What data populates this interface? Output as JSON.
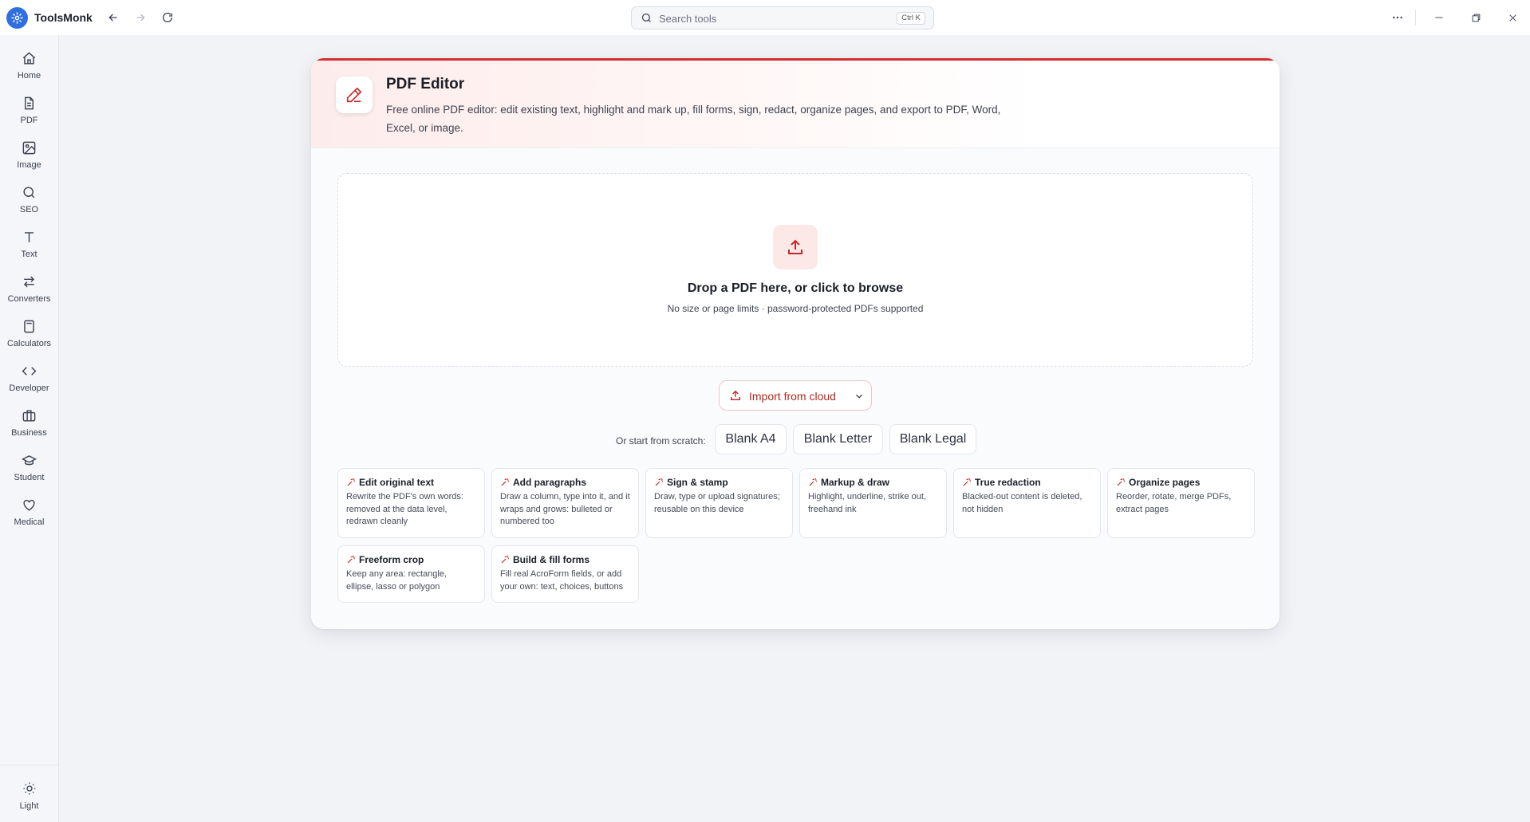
{
  "app": {
    "name": "ToolsMonk",
    "search_placeholder": "Search tools",
    "search_shortcut": "Ctrl K"
  },
  "sidebar": {
    "items": [
      {
        "label": "Home",
        "icon": "home-icon"
      },
      {
        "label": "PDF",
        "icon": "file-icon"
      },
      {
        "label": "Image",
        "icon": "image-icon"
      },
      {
        "label": "SEO",
        "icon": "search-icon"
      },
      {
        "label": "Text",
        "icon": "type-icon"
      },
      {
        "label": "Converters",
        "icon": "arrows-icon"
      },
      {
        "label": "Calculators",
        "icon": "calculator-icon"
      },
      {
        "label": "Developer",
        "icon": "code-icon"
      },
      {
        "label": "Business",
        "icon": "briefcase-icon"
      },
      {
        "label": "Student",
        "icon": "graduation-cap-icon"
      },
      {
        "label": "Medical",
        "icon": "heart-icon"
      }
    ],
    "theme_label": "Light"
  },
  "tool": {
    "title": "PDF Editor",
    "description": "Free online PDF editor: edit existing text, highlight and mark up, fill forms, sign, redact, organize pages, and export to PDF, Word, Excel, or image.",
    "accent_color": "#d32f2f"
  },
  "dropzone": {
    "title": "Drop a PDF here, or click to browse",
    "subtitle": "No size or page limits · password-protected PDFs supported"
  },
  "cloud": {
    "label": "Import from cloud"
  },
  "scratch": {
    "label": "Or start from scratch:",
    "options": [
      "Blank A4",
      "Blank Letter",
      "Blank Legal"
    ]
  },
  "features": [
    {
      "title": "Edit original text",
      "desc": "Rewrite the PDF's own words: removed at the data level, redrawn cleanly"
    },
    {
      "title": "Add paragraphs",
      "desc": "Draw a column, type into it, and it wraps and grows: bulleted or numbered too"
    },
    {
      "title": "Sign & stamp",
      "desc": "Draw, type or upload signatures; reusable on this device"
    },
    {
      "title": "Markup & draw",
      "desc": "Highlight, underline, strike out, freehand ink"
    },
    {
      "title": "True redaction",
      "desc": "Blacked-out content is deleted, not hidden"
    },
    {
      "title": "Organize pages",
      "desc": "Reorder, rotate, merge PDFs, extract pages"
    },
    {
      "title": "Freeform crop",
      "desc": "Keep any area: rectangle, ellipse, lasso or polygon"
    },
    {
      "title": "Build & fill forms",
      "desc": "Fill real AcroForm fields, or add your own: text, choices, buttons"
    }
  ]
}
